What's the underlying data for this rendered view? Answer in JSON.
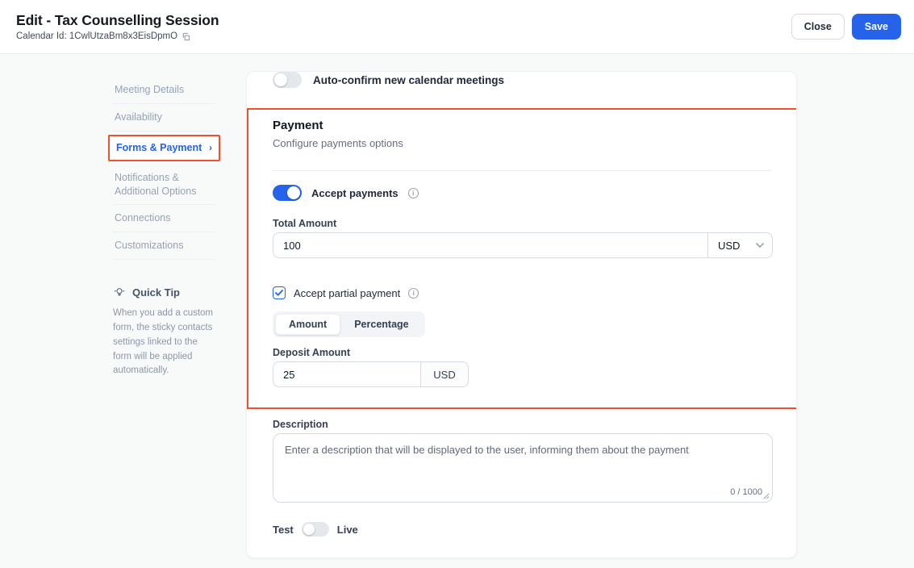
{
  "header": {
    "title": "Edit - Tax Counselling Session",
    "calendar_id": "Calendar Id: 1CwlUtzaBm8x3EisDpmO",
    "close_label": "Close",
    "save_label": "Save"
  },
  "colors": {
    "accent_blue": "#2563eb",
    "annotation_red": "#f0512c",
    "page_background": "#f8fafa",
    "toggle_off_gray": "#e4e7ec"
  },
  "icons": {
    "copy_icon": "overlapping-squares",
    "quick_tip_icon": "lightbulb",
    "chevron_right_icon": "›",
    "chevron_down_icon": "⌄",
    "info_icon": "circled-i",
    "resize_handle_icon": "diagonal-grip"
  },
  "sidebar": {
    "items": [
      {
        "label": "Meeting Details"
      },
      {
        "label": "Availability"
      },
      {
        "label": "Forms & Payment",
        "active": true,
        "chevron": "›"
      },
      {
        "label": "Notifications & Additional Options"
      },
      {
        "label": "Connections"
      },
      {
        "label": "Customizations"
      }
    ],
    "quick_tip": {
      "title": "Quick Tip",
      "text": "When you add a custom form, the sticky contacts settings linked to the form will be applied automatically."
    }
  },
  "main": {
    "auto_confirm_label": "Auto-confirm new calendar meetings",
    "payment": {
      "title": "Payment",
      "subtitle": "Configure payments options",
      "accept_payments_label": "Accept payments",
      "total_amount_label": "Total Amount",
      "total_amount_value": "100",
      "currency": "USD",
      "accept_partial_label": "Accept partial payment",
      "segment_amount": "Amount",
      "segment_percentage": "Percentage",
      "deposit_label": "Deposit Amount",
      "deposit_value": "25",
      "deposit_currency": "USD"
    },
    "description": {
      "label": "Description",
      "placeholder": "Enter a description that will be displayed to the user, informing them about the payment",
      "counter": "0 / 1000"
    },
    "mode_toggle": {
      "test_label": "Test",
      "live_label": "Live"
    }
  }
}
